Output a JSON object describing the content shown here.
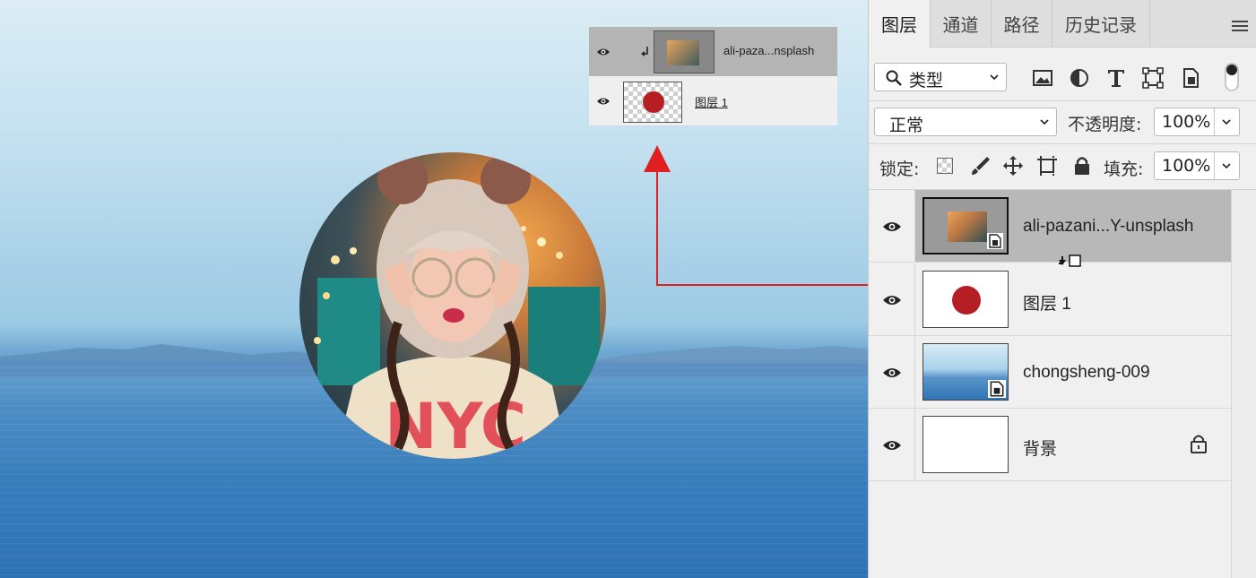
{
  "panel": {
    "tabs": [
      {
        "label": "图层"
      },
      {
        "label": "通道"
      },
      {
        "label": "路径"
      },
      {
        "label": "历史记录"
      }
    ],
    "filter_label": "类型",
    "blend_mode": "正常",
    "opacity_label": "不透明度:",
    "opacity_value": "100%",
    "lock_label": "锁定:",
    "fill_label": "填充:",
    "fill_value": "100%",
    "icons": {
      "menu": "panel-menu-icon",
      "filter": [
        "search-icon",
        "image-filter-icon",
        "adjustment-filter-icon",
        "type-filter-icon",
        "shape-filter-icon",
        "smart-object-filter-icon",
        "filter-toggle-icon"
      ],
      "lock": [
        "lock-transparent-icon",
        "lock-image-icon",
        "lock-position-icon",
        "lock-artboard-icon",
        "lock-all-icon"
      ]
    },
    "layers": [
      {
        "name": "ali-pazani...Y-unsplash",
        "selected": true,
        "visible": true
      },
      {
        "name": "图层 1",
        "selected": false,
        "visible": true
      },
      {
        "name": "chongsheng-009",
        "selected": false,
        "visible": true
      },
      {
        "name": "背景",
        "selected": false,
        "visible": true,
        "locked": true
      }
    ]
  },
  "preview": {
    "layers": [
      {
        "name": "ali-paza...nsplash",
        "selected": true
      },
      {
        "name": "图层 1",
        "selected": false
      }
    ]
  },
  "colors": {
    "accent_red": "#e02020",
    "circle_fill": "#b51f24",
    "selected_row": "#b8b8b8"
  }
}
